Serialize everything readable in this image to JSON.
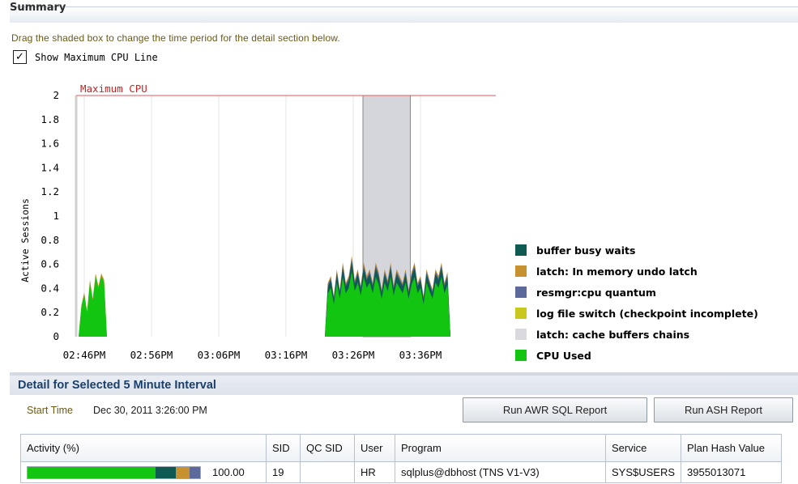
{
  "summary": {
    "title": "Summary",
    "hint": "Drag the shaded box to change the time period for the detail section below.",
    "show_max_cpu_label": "Show Maximum CPU Line",
    "show_max_cpu_checked": true
  },
  "chart_data": {
    "type": "area",
    "ylabel": "Active Sessions",
    "xlabel": "",
    "ylim": [
      0,
      2
    ],
    "y_ticks": [
      "0",
      "0.2",
      "0.4",
      "0.6",
      "0.8",
      "1",
      "1.2",
      "1.4",
      "1.6",
      "1.8",
      "2"
    ],
    "x_ticks": [
      "02:46PM",
      "02:56PM",
      "03:06PM",
      "03:16PM",
      "03:26PM",
      "03:36PM"
    ],
    "max_cpu": {
      "label": "Maximum CPU",
      "value": 2,
      "color": "#e05a5a"
    },
    "selected_interval": {
      "start": "03:26PM",
      "end": "03:31PM"
    },
    "series": [
      {
        "name": "buffer busy waits",
        "color": "#0f5a52"
      },
      {
        "name": "latch: In memory undo latch",
        "color": "#c6912e"
      },
      {
        "name": "resmgr:cpu quantum",
        "color": "#5b6a9a"
      },
      {
        "name": "log file switch (checkpoint incomplete)",
        "color": "#c8c81e"
      },
      {
        "name": "latch: cache buffers chains",
        "color": "#d9d9df"
      },
      {
        "name": "CPU Used",
        "color": "#11c511"
      }
    ],
    "cpu_used_samples": [
      {
        "time": "02:45PM",
        "values": [
          0,
          0.25,
          0.35,
          0.2,
          0.45,
          0.3,
          0.5,
          0.4,
          0.5,
          0.45,
          0
        ]
      },
      {
        "time": "03:22PM-03:38PM",
        "values": [
          0,
          0.4,
          0.45,
          0.3,
          0.5,
          0.35,
          0.55,
          0.4,
          0.45,
          0.6,
          0.42,
          0.5,
          0.38,
          0.55,
          0.45,
          0.5,
          0.4,
          0.55,
          0.48,
          0.35,
          0.5,
          0.42,
          0.55,
          0.38,
          0.5,
          0.45,
          0.4,
          0.5,
          0.35,
          0.48,
          0.55,
          0.4,
          0.45,
          0.3,
          0.5,
          0.42,
          0.35,
          0.5,
          0.45,
          0.55,
          0.4,
          0.48,
          0
        ]
      }
    ]
  },
  "detail": {
    "title": "Detail for Selected 5 Minute Interval",
    "start_time_label": "Start Time",
    "start_time_value": "Dec 30, 2011 3:26:00 PM",
    "run_awr_label": "Run AWR SQL Report",
    "run_ash_label": "Run ASH Report",
    "columns": [
      "Activity (%)",
      "SID",
      "QC SID",
      "User",
      "Program",
      "Service",
      "Plan Hash Value"
    ],
    "rows": [
      {
        "activity_pct": "100.00",
        "activity_breakdown": [
          {
            "name": "CPU Used",
            "fraction": 0.74,
            "color": "#11c511"
          },
          {
            "name": "buffer busy waits",
            "fraction": 0.12,
            "color": "#0f5a52"
          },
          {
            "name": "latch: In memory undo latch",
            "fraction": 0.08,
            "color": "#c6912e"
          },
          {
            "name": "resmgr:cpu quantum",
            "fraction": 0.06,
            "color": "#5b6a9a"
          }
        ],
        "sid": "19",
        "qc_sid": "",
        "user": "HR",
        "program": "sqlplus@dbhost (TNS V1-V3)",
        "service": "SYS$USERS",
        "plan_hash_value": "3955013071"
      }
    ]
  }
}
